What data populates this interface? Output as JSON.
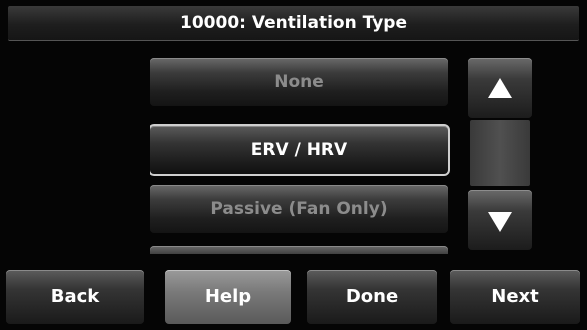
{
  "header": {
    "title": "10000: Ventilation Type"
  },
  "options": [
    {
      "label": "None",
      "state": "dim"
    },
    {
      "label": "ERV / HRV",
      "state": "selected"
    },
    {
      "label": "Passive (Fan Only)",
      "state": "dim"
    },
    {
      "label": "",
      "state": "partial"
    }
  ],
  "scroll": {
    "up_icon": "triangle-up",
    "down_icon": "triangle-down"
  },
  "footer": {
    "back": "Back",
    "help": "Help",
    "done": "Done",
    "next": "Next"
  }
}
